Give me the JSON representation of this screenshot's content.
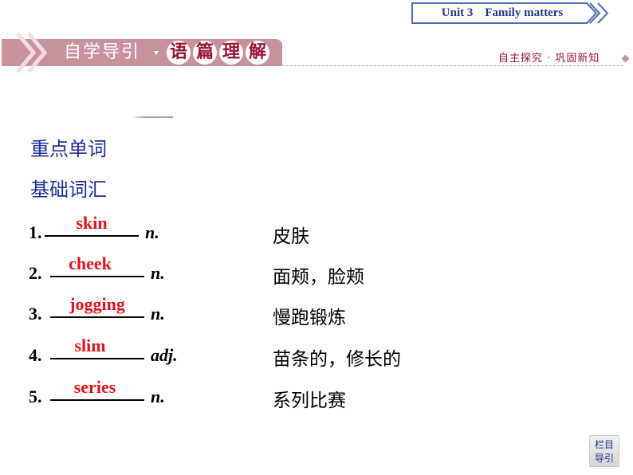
{
  "header": {
    "unit_title": "Unit 3    Family matters",
    "section_title": "自学导引",
    "section_subtitle_chars": [
      "语",
      "篇",
      "理",
      "解"
    ],
    "right_subtitle": "自主探究 · 巩固新知"
  },
  "content": {
    "heading_1": "重点单词",
    "heading_2": "基础词汇",
    "vocab": [
      {
        "number": "1.",
        "answer": "skin",
        "pos": "n.",
        "meaning": "皮肤"
      },
      {
        "number": "2.",
        "answer": "cheek",
        "pos": "n.",
        "meaning": "面颊，脸颊"
      },
      {
        "number": "3.",
        "answer": "jogging",
        "pos": "n.",
        "meaning": "慢跑锻炼"
      },
      {
        "number": "4.",
        "answer": "slim",
        "pos": "adj.",
        "meaning": "苗条的，修长的"
      },
      {
        "number": "5.",
        "answer": "series",
        "pos": "n.",
        "meaning": "系列比赛"
      }
    ]
  },
  "nav": {
    "line1": "栏目",
    "line2": "导引"
  },
  "colors": {
    "accent_pink": "#c8929c",
    "accent_crimson": "#9b1235",
    "heading_blue": "#1b2f9a",
    "answer_red": "#e0141c"
  }
}
